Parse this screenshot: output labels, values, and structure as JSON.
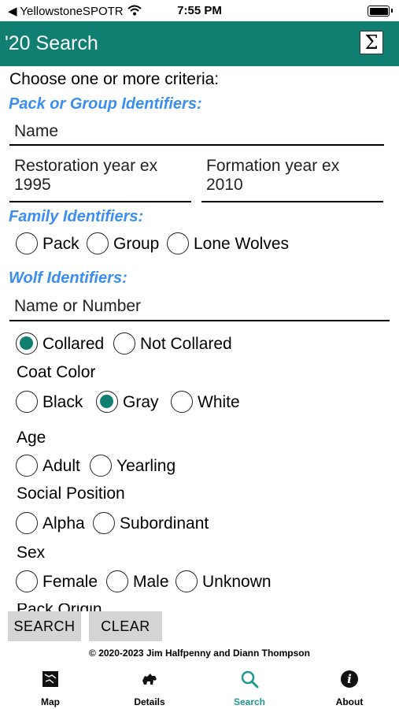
{
  "status_bar": {
    "carrier": "◀ YellowstoneSPOTR",
    "time": "7:55 PM"
  },
  "header": {
    "title": "'20 Search",
    "sigma": "Σ"
  },
  "prompt": "Choose one or more criteria:",
  "pack": {
    "heading": "Pack or Group Identifiers:",
    "name_placeholder": "Name",
    "restoration_line1": "Restoration year ex",
    "restoration_line2": "1995",
    "formation_line1": "Formation year ex",
    "formation_line2": "2010"
  },
  "family": {
    "heading": "Family Identifiers:",
    "options": [
      "Pack",
      "Group",
      "Lone Wolves"
    ]
  },
  "wolf": {
    "heading": "Wolf Identifiers:",
    "name_placeholder": "Name or Number",
    "collar_options": [
      "Collared",
      "Not Collared"
    ],
    "collar_selected": "Collared",
    "coat_label": "Coat Color",
    "coat_options": [
      "Black",
      "Gray",
      "White"
    ],
    "coat_selected": "Gray",
    "age_label": "Age",
    "age_options": [
      "Adult",
      "Yearling"
    ],
    "social_label": "Social Position",
    "social_options": [
      "Alpha",
      "Subordinant"
    ],
    "sex_label": "Sex",
    "sex_options": [
      "Female",
      "Male",
      "Unknown"
    ],
    "cutoff_label": "Pack Origin"
  },
  "buttons": {
    "search": "SEARCH",
    "clear": "CLEAR"
  },
  "copyright": "© 2020-2023 Jim Halfpenny and Diann Thompson",
  "tabs": [
    "Map",
    "Details",
    "Search",
    "About"
  ],
  "colors": {
    "accent": "#107f72",
    "section_heading": "#3b8ef0",
    "active_tab": "#1d9a8d"
  }
}
